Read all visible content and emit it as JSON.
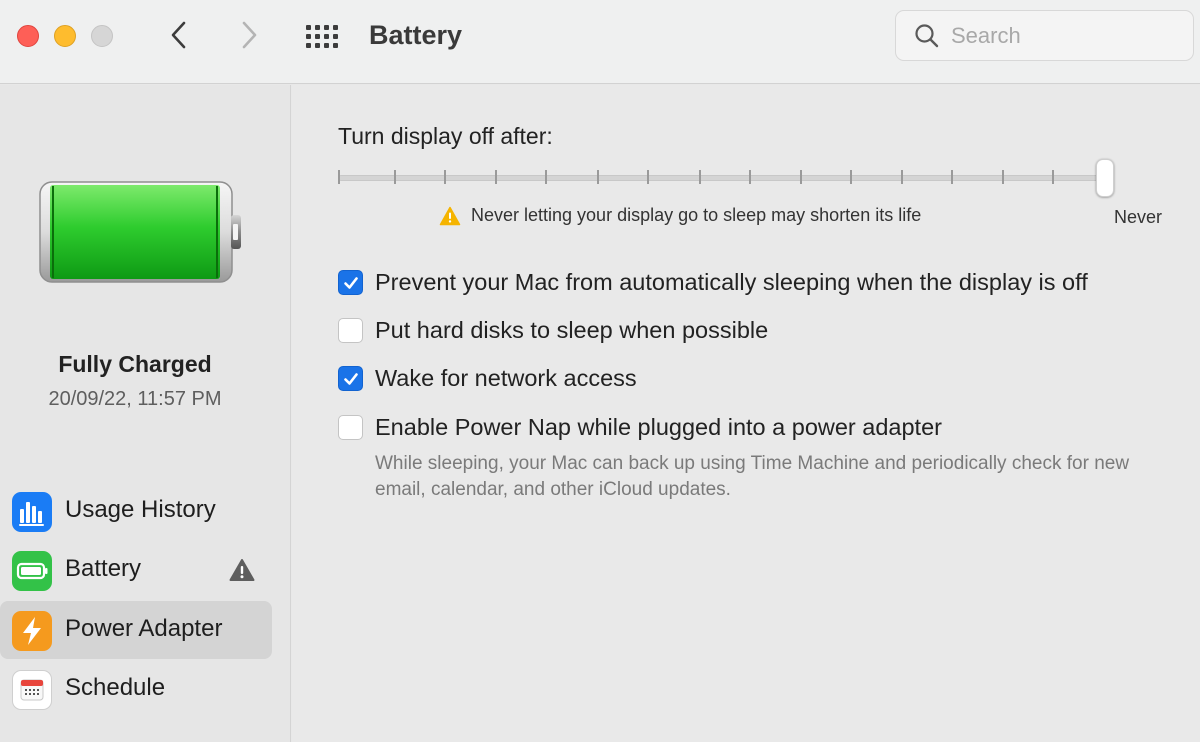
{
  "window": {
    "title": "Battery"
  },
  "search": {
    "placeholder": "Search"
  },
  "battery_status": {
    "state": "Fully Charged",
    "timestamp": "20/09/22, 11:57 PM",
    "charge_color": "#2ecc2e"
  },
  "sidebar": {
    "items": [
      {
        "label": "Usage History",
        "icon": "usage-history-icon",
        "color": "#1a7cf5",
        "selected": false,
        "warning": false
      },
      {
        "label": "Battery",
        "icon": "battery-icon",
        "color": "#33c248",
        "selected": false,
        "warning": true
      },
      {
        "label": "Power Adapter",
        "icon": "power-adapter-icon",
        "color": "#f59a1e",
        "selected": true,
        "warning": false
      },
      {
        "label": "Schedule",
        "icon": "calendar-icon",
        "color": "#ffffff",
        "selected": false,
        "warning": false
      }
    ]
  },
  "display_sleep": {
    "label": "Turn display off after:",
    "value": "Never",
    "warning": "Never letting your display go to sleep may shorten its life",
    "end_label": "Never"
  },
  "options": [
    {
      "label": "Prevent your Mac from automatically sleeping when the display is off",
      "checked": true
    },
    {
      "label": "Put hard disks to sleep when possible",
      "checked": false
    },
    {
      "label": "Wake for network access",
      "checked": true
    },
    {
      "label": "Enable Power Nap while plugged into a power adapter",
      "checked": false
    }
  ],
  "power_nap_hint": "While sleeping, your Mac can back up using Time Machine and periodically check for new email, calendar, and other iCloud updates.",
  "colors": {
    "accent": "#1a73e8",
    "warning": "#f5b400"
  }
}
